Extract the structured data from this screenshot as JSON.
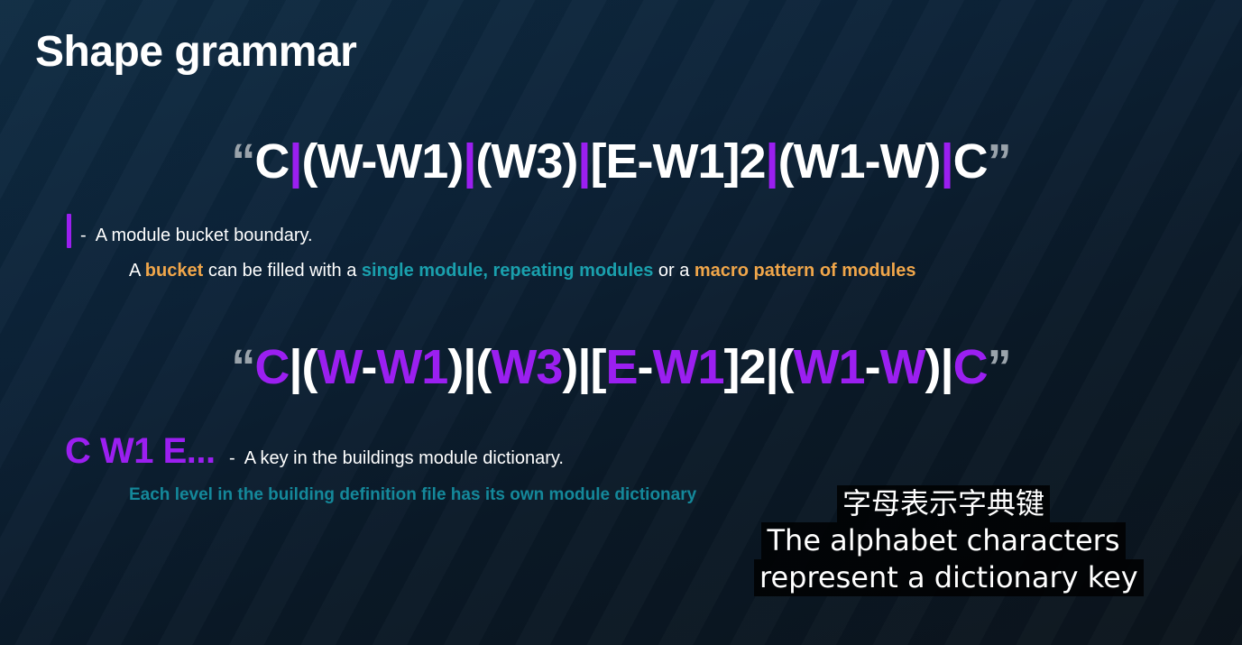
{
  "slide": {
    "title": "Shape grammar"
  },
  "formula_top": {
    "open_quote": "“",
    "t1": "C",
    "sep1": "|",
    "t2": "(W-W1)",
    "sep2": "|",
    "t3": "(W3)",
    "sep3": "|",
    "t4": "[E-W1]2",
    "sep4": "|",
    "t5": "(W1-W)",
    "sep5": "|",
    "t6": "C",
    "close_quote": "”"
  },
  "legend_pipe": {
    "dash": "-",
    "text": "A module bucket boundary.",
    "sub": {
      "a": "A ",
      "bucket": "bucket",
      "mid1": " can be filled with a ",
      "single": "single module, repeating modules",
      "mid2": " or a ",
      "macro": "macro pattern of modules"
    }
  },
  "formula_bottom": {
    "open_quote": "“",
    "k1": "C",
    "s1": "|(",
    "k2": "W",
    "s2": "-",
    "k3": "W1",
    "s3": ")|(",
    "k4": "W3",
    "s4": ")|[",
    "k5": "E",
    "s5": "-",
    "k6": "W1",
    "s6": "]2|(",
    "k7": "W1",
    "s7": "-",
    "k8": "W",
    "s8": ")|",
    "k9": "C",
    "close_quote": "”"
  },
  "legend_key": {
    "sample": "C W1 E...",
    "dash": "-",
    "text": "A key in the buildings module dictionary.",
    "sub": "Each level in the building definition file has its own module dictionary"
  },
  "subtitles": {
    "line_cn": "字母表示字典键",
    "line_en_1": "The alphabet characters",
    "line_en_2": "represent a dictionary key"
  },
  "colors": {
    "accent_purple": "#9b1ff0",
    "highlight_orange": "#f0a64a",
    "highlight_teal": "#1aa0ad",
    "sub_teal": "#14889a",
    "background": "#0c2237"
  }
}
